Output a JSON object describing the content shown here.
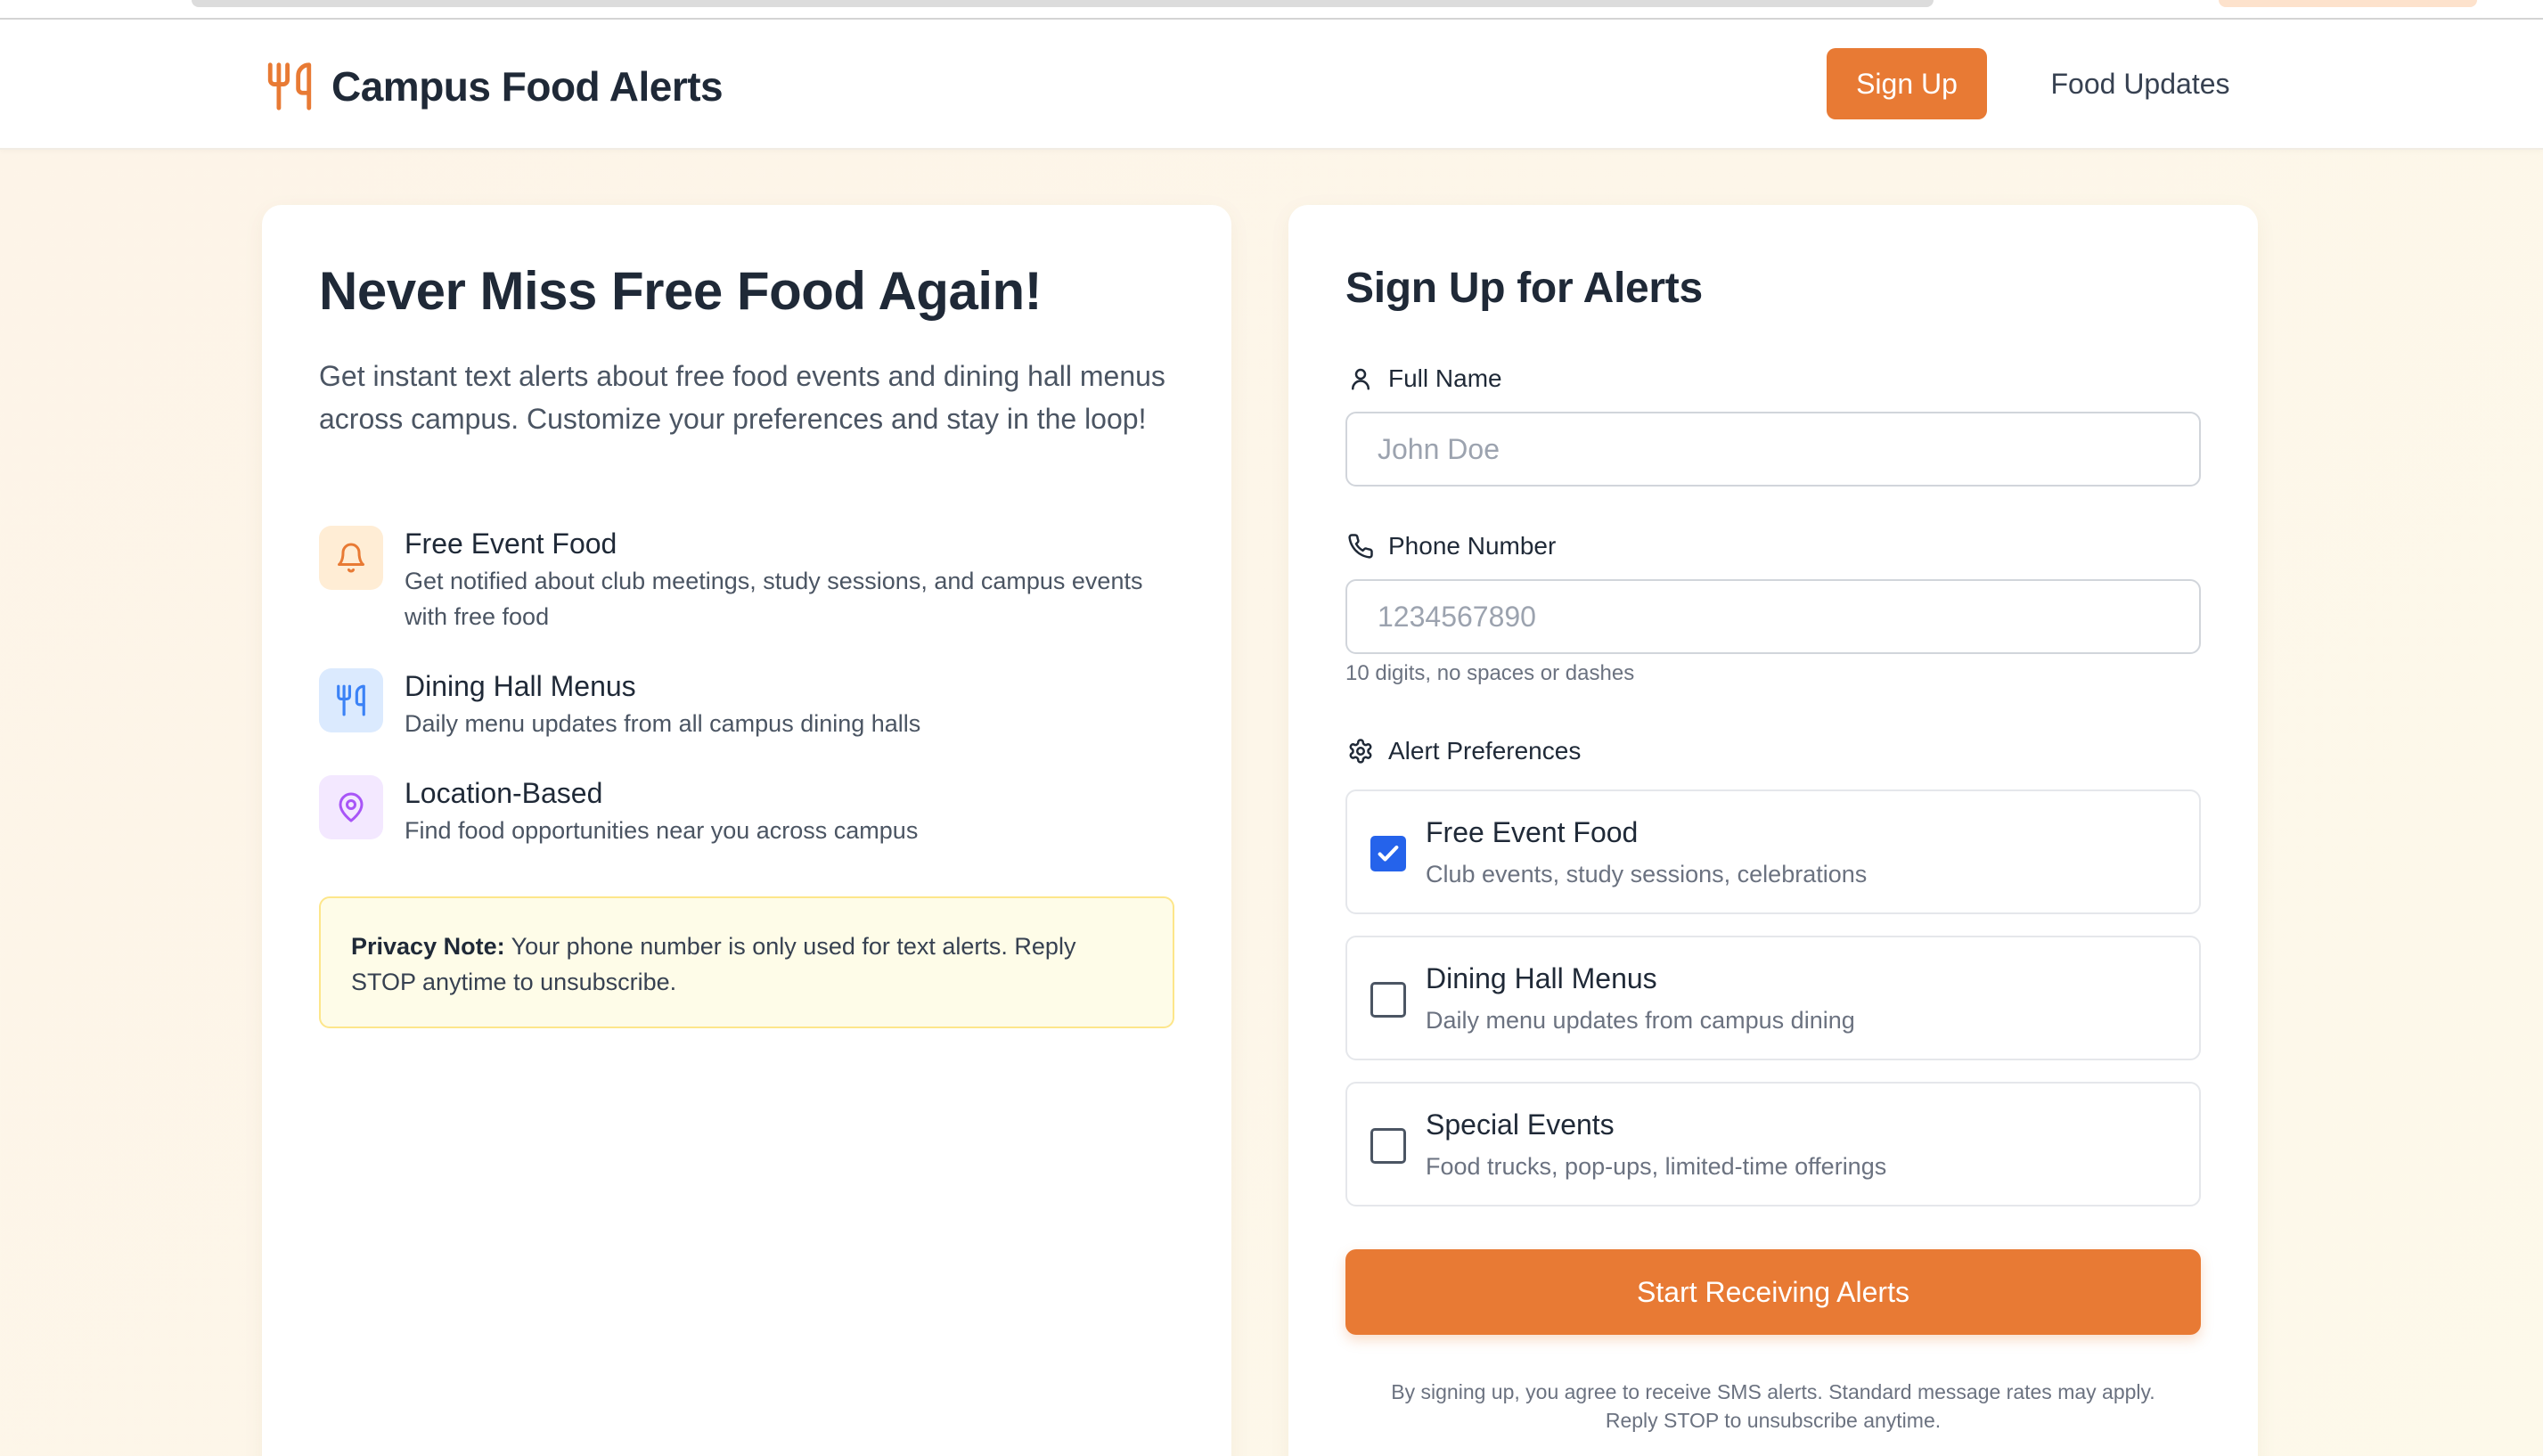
{
  "header": {
    "brand": "Campus Food Alerts",
    "nav": {
      "signup": "Sign Up",
      "updates": "Food Updates"
    }
  },
  "hero": {
    "title": "Never Miss Free Food Again!",
    "description": "Get instant text alerts about free food events and dining hall menus across campus. Customize your preferences and stay in the loop!"
  },
  "features": [
    {
      "icon": "bell-icon",
      "title": "Free Event Food",
      "desc": "Get notified about club meetings, study sessions, and campus events with free food"
    },
    {
      "icon": "utensils-icon",
      "title": "Dining Hall Menus",
      "desc": "Daily menu updates from all campus dining halls"
    },
    {
      "icon": "map-pin-icon",
      "title": "Location-Based",
      "desc": "Find food opportunities near you across campus"
    }
  ],
  "privacy": {
    "label": "Privacy Note:",
    "text": " Your phone number is only used for text alerts. Reply STOP anytime to unsubscribe."
  },
  "form": {
    "title": "Sign Up for Alerts",
    "name_label": "Full Name",
    "name_placeholder": "John Doe",
    "phone_label": "Phone Number",
    "phone_placeholder": "1234567890",
    "phone_hint": "10 digits, no spaces or dashes",
    "prefs_label": "Alert Preferences",
    "prefs": [
      {
        "title": "Free Event Food",
        "desc": "Club events, study sessions, celebrations",
        "checked": true
      },
      {
        "title": "Dining Hall Menus",
        "desc": "Daily menu updates from campus dining",
        "checked": false
      },
      {
        "title": "Special Events",
        "desc": "Food trucks, pop-ups, limited-time offerings",
        "checked": false
      }
    ],
    "submit": "Start Receiving Alerts",
    "terms_line1": "By signing up, you agree to receive SMS alerts. Standard message rates may apply.",
    "terms_line2": "Reply STOP to unsubscribe anytime."
  },
  "colors": {
    "accent": "#e87a34",
    "checkbox": "#2563eb",
    "background": "#fdf6e9"
  }
}
